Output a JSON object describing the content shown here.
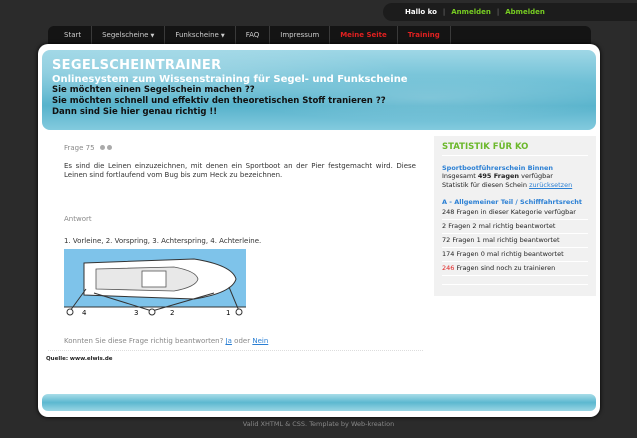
{
  "userbar": {
    "greeting": "Hallo ko",
    "sep1": "|",
    "login": "Anmelden",
    "sep2": "|",
    "logout": "Abmelden"
  },
  "nav": {
    "start": "Start",
    "segel": "Segelscheine",
    "funk": "Funkscheine",
    "faq": "FAQ",
    "impressum": "Impressum",
    "meine_seite": "Meine Seite",
    "training": "Training"
  },
  "banner": {
    "title": "SEGELSCHEINTRAINER",
    "subtitle": "Onlinesystem zum Wissenstraining für Segel- und Funkscheine",
    "line1": "Sie möchten einen Segelschein machen ??",
    "line2": "Sie möchten schnell und effektiv den theoretischen Stoff tranieren ??",
    "line3": "Dann sind Sie hier genau richtig !!"
  },
  "question": {
    "label": "Frage 75",
    "text": "Es sind die Leinen einzuzeichnen, mit denen ein Sportboot an der Pier festgemacht wird. Diese Leinen sind fortlaufend vom Bug bis zum Heck zu bezeichnen.",
    "answer_label": "Antwort",
    "answer_text": "1. Vorleine, 2. Vorspring, 3. Achterspring, 4. Achterleine.",
    "feedback_prefix": "Konnten Sie diese Frage richtig beantworten?",
    "yes": "Ja",
    "or": "oder",
    "no": "Nein",
    "source": "Quelle: www.elwis.de",
    "diagram_labels": [
      "4",
      "3",
      "2",
      "1"
    ]
  },
  "sidebar": {
    "heading": "STATISTIK FÜR KO",
    "section1": "Sportbootführerschein Binnen",
    "total_prefix": "Insgesamt",
    "total_count": "495 Fragen",
    "total_suffix": "verfügbar",
    "reset_prefix": "Statistik für diesen Schein",
    "reset_link": "zurücksetzen",
    "section2": "A - Allgemeiner Teil / Schifffahrtsrecht",
    "stat1": "248 Fragen in dieser Kategorie verfügbar",
    "stat2": "2 Fragen 2 mal richtig beantwortet",
    "stat3": "72 Fragen 1 mal richtig beantwortet",
    "stat4": "174 Fragen 0 mal richtig beantwortet",
    "remaining_count": "246",
    "remaining_text": "Fragen sind noch zu trainieren"
  },
  "footer": {
    "text": "Valid XHTML & CSS. Template by Web-kreation"
  }
}
